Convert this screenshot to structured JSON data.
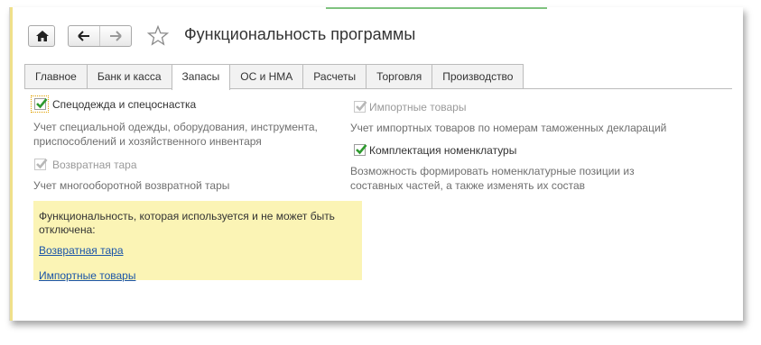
{
  "window": {
    "title": "Функциональность программы"
  },
  "toolbar": {
    "home_icon": "home-icon",
    "back_icon": "arrow-left-icon",
    "forward_icon": "arrow-right-icon",
    "favorite_icon": "star-icon"
  },
  "tabs": [
    {
      "label": "Главное",
      "active": false
    },
    {
      "label": "Банк и касса",
      "active": false
    },
    {
      "label": "Запасы",
      "active": true
    },
    {
      "label": "ОС и НМА",
      "active": false
    },
    {
      "label": "Расчеты",
      "active": false
    },
    {
      "label": "Торговля",
      "active": false
    },
    {
      "label": "Производство",
      "active": false
    }
  ],
  "options": {
    "workwear": {
      "label": "Спецодежда и спецоснастка",
      "checked": true,
      "enabled": true,
      "description": "Учет специальной одежды, оборудования, инструмента, приспособлений и хозяйственного инвентаря"
    },
    "returnable": {
      "label": "Возвратная тара",
      "checked": true,
      "enabled": false,
      "description": "Учет многооборотной возвратной тары"
    },
    "imports": {
      "label": "Импортные товары",
      "checked": true,
      "enabled": false,
      "description": "Учет импортных товаров по номерам таможенных деклараций"
    },
    "kitting": {
      "label": "Комплектация номенклатуры",
      "checked": true,
      "enabled": true,
      "description": "Возможность формировать номенклатурные позиции из составных частей, а также изменять их состав"
    }
  },
  "notice": {
    "text": "Функциональность, которая используется и не может быть отключена:",
    "links": [
      "Возвратная тара",
      "Импортные товары"
    ]
  },
  "colors": {
    "check_enabled": "#2e9a2e",
    "check_disabled": "#b8b8b8",
    "notice_bg": "#fbf4b5",
    "link": "#1b55a8"
  }
}
